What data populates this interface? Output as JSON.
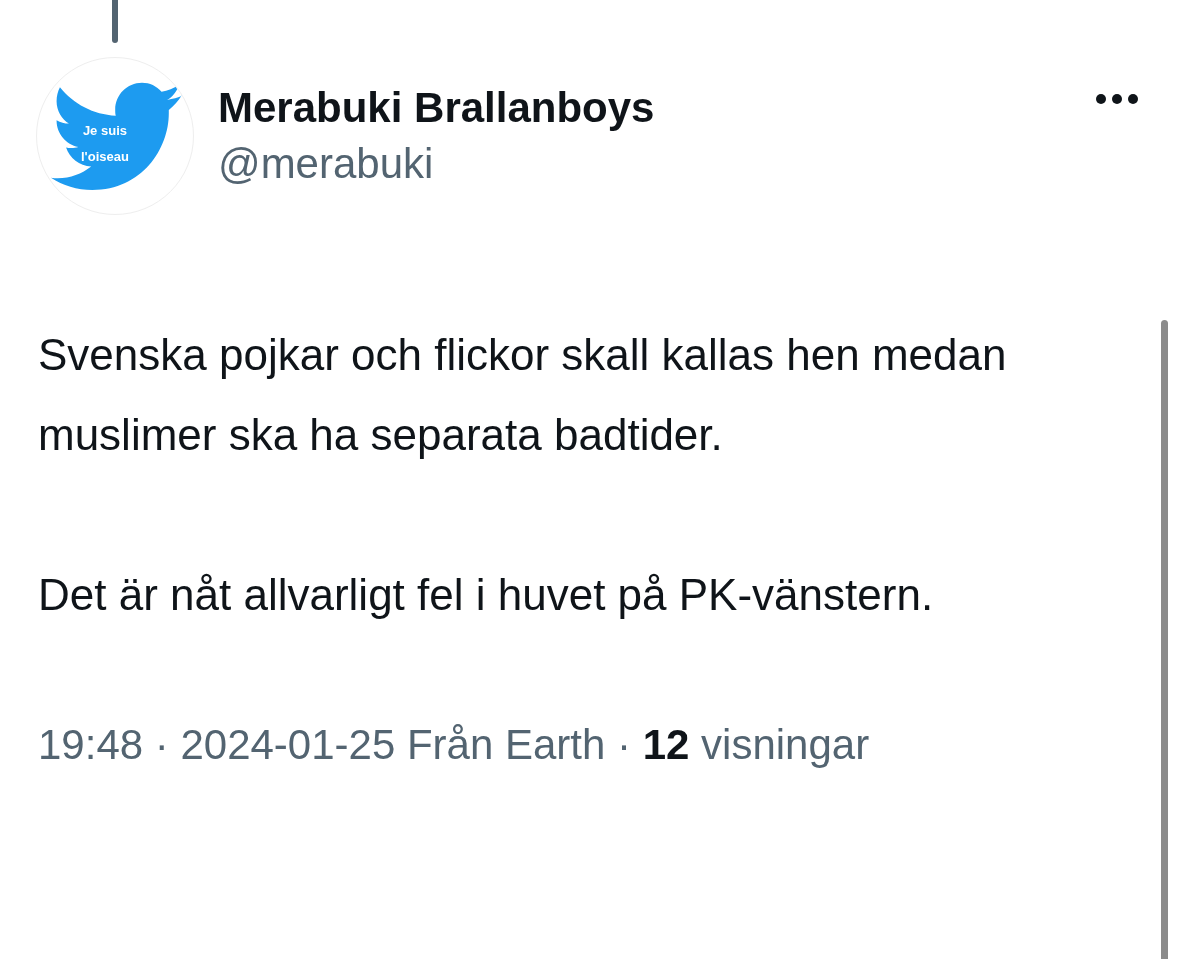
{
  "author": {
    "name": "Merabuki Brallanboys",
    "handle": "@merabuki",
    "avatar_text": [
      "Je suis",
      "l'oiseau"
    ]
  },
  "body": [
    "Svenska pojkar och flickor skall kallas hen medan muslimer ska ha separata badtider.",
    "Det är nåt allvarligt fel i huvet på PK-vänstern."
  ],
  "meta": "19:48 · 2024-01-25 Från Earth · **12** visningar"
}
